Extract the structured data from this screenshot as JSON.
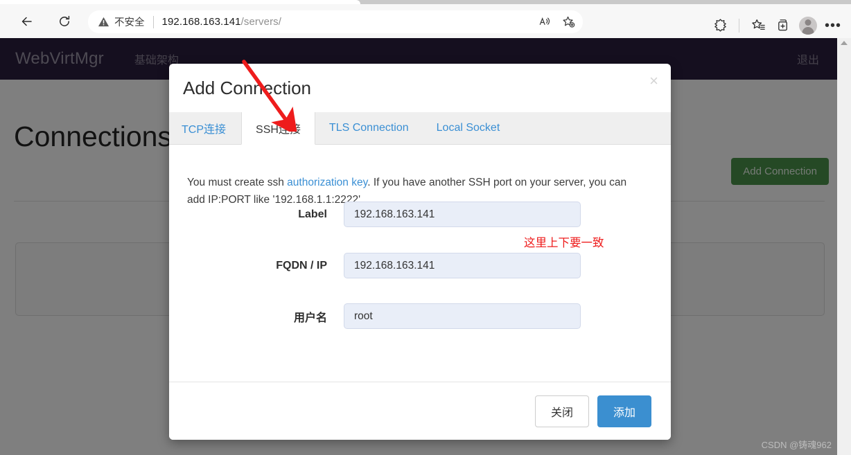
{
  "browser": {
    "back_icon": "back-arrow-icon",
    "reload_icon": "reload-icon",
    "security_label": "不安全",
    "url_host": "192.168.163.141",
    "url_path": "/servers/",
    "warning_icon": "warning-triangle-icon",
    "read_aloud_icon": "read-aloud-icon",
    "add_favorite_icon": "add-favorite-star-icon",
    "browser_essentials_icon": "browser-essentials-icon",
    "collections_icon": "collections-icon",
    "split_screen_icon": "split-screen-icon",
    "profile_icon": "profile-avatar-icon",
    "settings_icon": "settings-more-icon"
  },
  "navbar": {
    "brand": "WebVirtMgr",
    "links": [
      {
        "label": "基础架构"
      }
    ],
    "logout": "退出"
  },
  "page": {
    "title": "Connections",
    "add_connection_button": "Add Connection"
  },
  "modal": {
    "title": "Add Connection",
    "close_icon": "×",
    "tabs": [
      {
        "label": "TCP连接",
        "active": false
      },
      {
        "label": "SSH连接",
        "active": true
      },
      {
        "label": "TLS Connection",
        "active": false
      },
      {
        "label": "Local Socket",
        "active": false
      }
    ],
    "help": {
      "before_link": "You must create ssh ",
      "link_text": "authorization key",
      "after_link": ". If you have another SSH port on your server, you can add IP:PORT like '192.168.1.1:2222'."
    },
    "fields": [
      {
        "label": "Label",
        "value": "192.168.163.141",
        "placeholder": ""
      },
      {
        "label": "FQDN / IP",
        "value": "192.168.163.141",
        "placeholder": ""
      },
      {
        "label": "用户名",
        "value": "root",
        "placeholder": ""
      }
    ],
    "annotation": "这里上下要一致",
    "footer": {
      "close_label": "关闭",
      "add_label": "添加"
    }
  },
  "watermark": "CSDN @铸魂962",
  "colors": {
    "navbar_bg": "#2b1f3f",
    "primary_button": "#3b8fd0",
    "success_button": "#4a934a",
    "link": "#3a8fd4",
    "annotation_red": "#ee1c1c",
    "input_bg": "#e9eef8"
  }
}
